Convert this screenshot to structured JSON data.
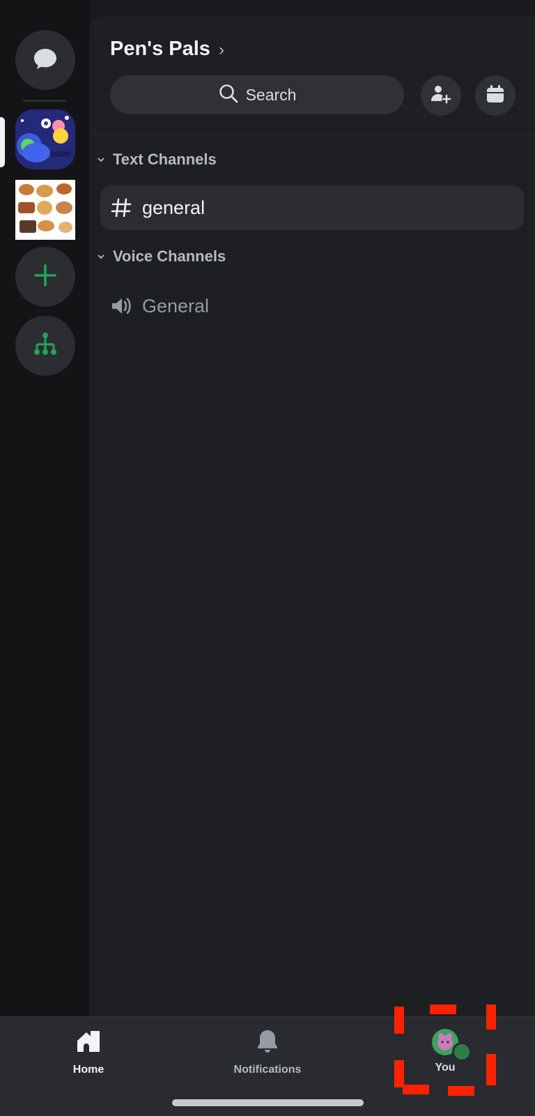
{
  "server": {
    "name": "Pen's Pals",
    "chevron": "›"
  },
  "search": {
    "label": "Search"
  },
  "header_actions": [
    {
      "icon": "invite-member-icon"
    },
    {
      "icon": "calendar-icon"
    }
  ],
  "categories": {
    "text": {
      "label": "Text Channels"
    },
    "voice": {
      "label": "Voice Channels"
    }
  },
  "channels": {
    "text": [
      {
        "name": "general",
        "icon": "hash-icon",
        "selected": true
      }
    ],
    "voice": [
      {
        "name": "General",
        "icon": "speaker-icon"
      }
    ]
  },
  "rail": {
    "items": [
      {
        "icon": "direct-messages-icon"
      },
      {
        "icon": "server-art-icon",
        "selected": true
      },
      {
        "icon": "pastries-server-icon"
      },
      {
        "icon": "add-server-icon"
      },
      {
        "icon": "discover-hub-icon"
      }
    ]
  },
  "nav": {
    "home": {
      "label": "Home",
      "icon": "home-icon"
    },
    "notifications": {
      "label": "Notifications",
      "icon": "bell-icon"
    },
    "you": {
      "label": "You",
      "icon": "avatar-icon"
    }
  },
  "colors": {
    "background": "#1a1a1e",
    "rail": "#141417",
    "panel": "#1e1f23",
    "accent_green": "#23a55a",
    "annotation_red": "#ff2200",
    "text_primary": "#f2f3f5",
    "text_muted": "#949ba4"
  }
}
